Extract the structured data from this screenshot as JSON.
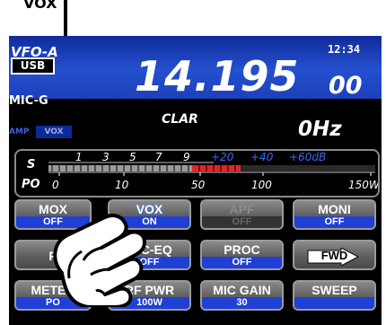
{
  "callout": {
    "label": "VOX"
  },
  "status": {
    "vfo": "VFO-A",
    "mode": "USB",
    "mic_label": "MIC-G",
    "clock": "12:34",
    "amp_label": "AMP",
    "vox_indicator": "VOX"
  },
  "frequency": {
    "main": "14.195",
    "sub": "00"
  },
  "clar": {
    "label": "CLAR",
    "offset": "0Hz"
  },
  "meter": {
    "s_label": "S",
    "po_label": "PO",
    "s_scale": [
      "1",
      "3",
      "5",
      "7",
      "9",
      "+20",
      "+40",
      "+60dB"
    ],
    "po_scale": [
      "0",
      "10",
      "50",
      "100",
      "150W"
    ]
  },
  "buttons": [
    {
      "id": "mox",
      "label": "MOX",
      "value": "OFF",
      "state": "normal"
    },
    {
      "id": "vox",
      "label": "VOX",
      "value": "ON",
      "state": "active"
    },
    {
      "id": "apf",
      "label": "APF",
      "value": "OFF",
      "state": "dim"
    },
    {
      "id": "moni",
      "label": "MONI",
      "value": "OFF",
      "state": "normal"
    },
    {
      "id": "prev",
      "label": "P",
      "value": "",
      "state": "normal"
    },
    {
      "id": "mic-eq",
      "label": "MIC-EQ",
      "value": "OFF",
      "state": "normal"
    },
    {
      "id": "proc",
      "label": "PROC",
      "value": "OFF",
      "state": "normal"
    },
    {
      "id": "fwd",
      "label": "FWD",
      "value": "",
      "state": "normal"
    },
    {
      "id": "meter",
      "label": "METER",
      "value": "PO",
      "state": "normal"
    },
    {
      "id": "rf-pwr",
      "label": "RF PWR",
      "value": "100W",
      "state": "normal"
    },
    {
      "id": "mic-gain",
      "label": "MIC GAIN",
      "value": "30",
      "state": "normal"
    },
    {
      "id": "sweep",
      "label": "SWEEP",
      "value": "",
      "state": "normal"
    }
  ],
  "colors": {
    "accent_blue": "#1f3fd6",
    "meter_red": "#e0262a",
    "scale_blue": "#3a66ff"
  }
}
